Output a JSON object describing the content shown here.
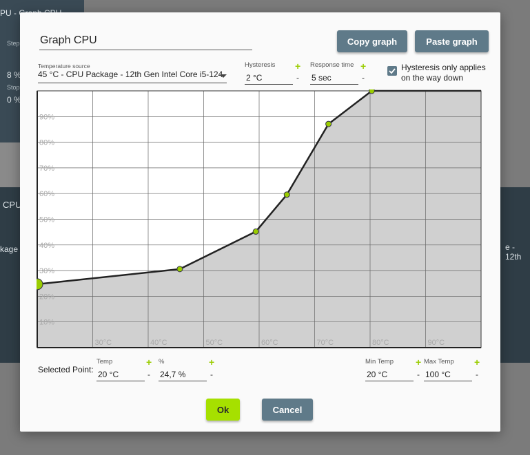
{
  "background": {
    "top_panel_text": "PU - Graph CPU",
    "steps_label": "Step",
    "steps_value": "8 %",
    "stop_label": "Stop",
    "stop_value": "0 %",
    "mid_title": "CPU",
    "mid_left_text": "kage -",
    "mid_right_text": "e - 12th"
  },
  "dialog": {
    "name": "Graph CPU",
    "copy_label": "Copy graph",
    "paste_label": "Paste graph",
    "temp_source_label": "Temperature source",
    "temp_source_value": "45 °C - CPU Package - 12th Gen Intel Core i5-124",
    "hysteresis_label": "Hysteresis",
    "hysteresis_value": "2 °C",
    "response_label": "Response time",
    "response_value": "5 sec",
    "hyst_down_label_1": "Hysteresis only applies",
    "hyst_down_label_2": "on the way down",
    "hyst_down_checked": true,
    "plus": "+",
    "minus": "-",
    "selected_point_label": "Selected Point:",
    "temp_label": "Temp",
    "temp_value": "20 °C",
    "pct_label": "%",
    "pct_value": "24,7 %",
    "min_temp_label": "Min Temp",
    "min_temp_value": "20 °C",
    "max_temp_label": "Max Temp",
    "max_temp_value": "100 °C",
    "ok_label": "Ok",
    "cancel_label": "Cancel"
  },
  "colors": {
    "accent": "#9acd00",
    "button": "#5f7a89",
    "curve_fill": "#d0d0d0"
  },
  "chart_data": {
    "type": "line",
    "x_tick_labels": [
      "30°C",
      "40°C",
      "50°C",
      "60°C",
      "70°C",
      "80°C",
      "90°C"
    ],
    "y_tick_labels": [
      "10%",
      "20%",
      "30%",
      "40%",
      "50%",
      "60%",
      "70%",
      "80%",
      "90%"
    ],
    "xlim": [
      20,
      100
    ],
    "ylim": [
      0,
      100
    ],
    "grid": true,
    "points": [
      {
        "x": 20,
        "y": 24.7
      },
      {
        "x": 45.7,
        "y": 30.6
      },
      {
        "x": 59.4,
        "y": 45.2
      },
      {
        "x": 65,
        "y": 59.6
      },
      {
        "x": 72.5,
        "y": 87.1
      },
      {
        "x": 80.3,
        "y": 100
      }
    ],
    "selected_index": 0
  }
}
